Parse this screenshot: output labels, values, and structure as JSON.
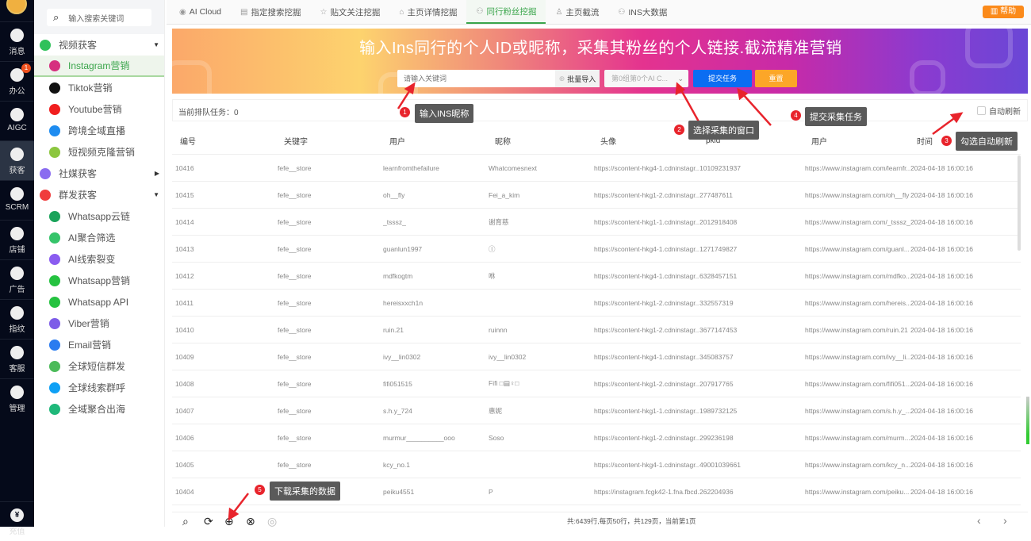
{
  "rail": {
    "items": [
      {
        "label": "消息",
        "icon": "message-icon"
      },
      {
        "label": "办公",
        "icon": "office-icon",
        "badge": "1"
      },
      {
        "label": "AIGC",
        "icon": "aigc-icon"
      },
      {
        "label": "获客",
        "icon": "customer-icon",
        "active": true
      },
      {
        "label": "SCRM",
        "icon": "scrm-icon"
      },
      {
        "label": "店铺",
        "icon": "store-icon"
      },
      {
        "label": "广告",
        "icon": "ads-icon"
      },
      {
        "label": "指纹",
        "icon": "fingerprint-icon"
      },
      {
        "label": "客服",
        "icon": "service-icon"
      },
      {
        "label": "管理",
        "icon": "manage-icon"
      }
    ],
    "bottom": {
      "label": "充值",
      "icon": "recharge-icon"
    }
  },
  "sidebar": {
    "search_placeholder": "输入搜索关键词",
    "groups": [
      {
        "label": "视频获客",
        "color": "#2fc15a",
        "expanded": true,
        "items": [
          {
            "label": "Instagram营销",
            "color": "#d6307f",
            "active": true
          },
          {
            "label": "Tiktok营销",
            "color": "#111"
          },
          {
            "label": "Youtube营销",
            "color": "#f01e1e"
          },
          {
            "label": "跨境全域直播",
            "color": "#1e8cf0"
          },
          {
            "label": "短视频克隆营销",
            "color": "#8cc63f"
          }
        ]
      },
      {
        "label": "社媒获客",
        "color": "#8a6cf0",
        "expanded": false,
        "items": []
      },
      {
        "label": "群发获客",
        "color": "#f03c3c",
        "expanded": true,
        "items": [
          {
            "label": "Whatsapp云链",
            "color": "#1aa35a"
          },
          {
            "label": "AI聚合筛选",
            "color": "#35c46a"
          },
          {
            "label": "AI线索裂变",
            "color": "#8a5cf0"
          },
          {
            "label": "Whatsapp营销",
            "color": "#25c240"
          },
          {
            "label": "Whatsapp API",
            "color": "#25c240"
          },
          {
            "label": "Viber营销",
            "color": "#7d5ce8"
          },
          {
            "label": "Email营销",
            "color": "#2a7cf0"
          },
          {
            "label": "全球短信群发",
            "color": "#4cbb5a"
          },
          {
            "label": "全球线索群呼",
            "color": "#0ea0f5"
          },
          {
            "label": "全域聚合出海",
            "color": "#1fb87a"
          }
        ]
      }
    ]
  },
  "tabs": [
    {
      "label": "AI Cloud",
      "icon": "cloud-icon"
    },
    {
      "label": "指定搜索挖掘",
      "icon": "search-doc-icon"
    },
    {
      "label": "贴文关注挖掘",
      "icon": "star-icon"
    },
    {
      "label": "主页详情挖掘",
      "icon": "home-icon"
    },
    {
      "label": "同行粉丝挖掘",
      "icon": "users-icon",
      "active": true
    },
    {
      "label": "主页截流",
      "icon": "user-icon"
    },
    {
      "label": "INS大数据",
      "icon": "users-icon"
    }
  ],
  "help_label": "帮助",
  "banner": {
    "title": "输入Ins同行的个人ID或昵称，采集其粉丝的个人链接.截流精准营销",
    "keyword_placeholder": "请输入关键词",
    "import_label": "批量导入",
    "window_select": "第0组第0个AI C...",
    "submit_label": "提交任务",
    "reset_label": "重置"
  },
  "queue": {
    "label": "当前排队任务：",
    "count": "0",
    "auto_refresh_label": "自动刷新",
    "auto_refresh_checked": false
  },
  "table": {
    "headers": [
      "编号",
      "关键字",
      "用户",
      "昵称",
      "头像",
      "pkid",
      "用户",
      "时间"
    ],
    "rows": [
      [
        "10416",
        "fefe__store",
        "learnfromthefailure",
        "Whatcomesnext",
        "https://scontent-hkg4-1.cdninstagr...",
        "10109231937",
        "https://www.instagram.com/learnfr...",
        "2024-04-18 16:00:16"
      ],
      [
        "10415",
        "fefe__store",
        "oh__fly",
        "Fei_a_kim",
        "https://scontent-hkg1-2.cdninstagr...",
        "277487611",
        "https://www.instagram.com/oh__fly",
        "2024-04-18 16:00:16"
      ],
      [
        "10414",
        "fefe__store",
        "_tsssz_",
        "谢育慈",
        "https://scontent-hkg1-1.cdninstagr...",
        "2012918408",
        "https://www.instagram.com/_tsssz_",
        "2024-04-18 16:00:16"
      ],
      [
        "10413",
        "fefe__store",
        "guanlun1997",
        "ⓛ",
        "https://scontent-hkg4-1.cdninstagr...",
        "1271749827",
        "https://www.instagram.com/guanl...",
        "2024-04-18 16:00:16"
      ],
      [
        "10412",
        "fefe__store",
        "mdfkogtm",
        "咻",
        "https://scontent-hkg4-1.cdninstagr...",
        "6328457151",
        "https://www.instagram.com/mdfko...",
        "2024-04-18 16:00:16"
      ],
      [
        "10411",
        "fefe__store",
        "hereisxxch1n",
        "",
        "https://scontent-hkg1-2.cdninstagr...",
        "332557319",
        "https://www.instagram.com/hereis...",
        "2024-04-18 16:00:16"
      ],
      [
        "10410",
        "fefe__store",
        "ruin.21",
        "ruinnn",
        "https://scontent-hkg1-2.cdninstagr...",
        "3677147453",
        "https://www.instagram.com/ruin.21",
        "2024-04-18 16:00:16"
      ],
      [
        "10409",
        "fefe__store",
        "ivy__lin0302",
        "ivy__lin0302",
        "https://scontent-hkg4-1.cdninstagr...",
        "345083757",
        "https://www.instagram.com/ivy__li...",
        "2024-04-18 16:00:16"
      ],
      [
        "10408",
        "fefe__store",
        "fifi051515",
        "Fifi □▤♀□",
        "https://scontent-hkg1-2.cdninstagr...",
        "207917765",
        "https://www.instagram.com/fifi051...",
        "2024-04-18 16:00:16"
      ],
      [
        "10407",
        "fefe__store",
        "s.h.y_724",
        "惠妮",
        "https://scontent-hkg1-1.cdninstagr...",
        "1989732125",
        "https://www.instagram.com/s.h.y_...",
        "2024-04-18 16:00:16"
      ],
      [
        "10406",
        "fefe__store",
        "murmur__________ooo",
        "Soso",
        "https://scontent-hkg1-2.cdninstagr...",
        "299236198",
        "https://www.instagram.com/murm...",
        "2024-04-18 16:00:16"
      ],
      [
        "10405",
        "fefe__store",
        "kcy_no.1",
        "",
        "https://scontent-hkg4-1.cdninstagr...",
        "49001039661",
        "https://www.instagram.com/kcy_n...",
        "2024-04-18 16:00:16"
      ],
      [
        "10404",
        "fefe__store",
        "peiku4551",
        "P",
        "https://instagram.fcgk42-1.fna.fbcd...",
        "262204936",
        "https://www.instagram.com/peiku...",
        "2024-04-18 16:00:16"
      ]
    ]
  },
  "footer": {
    "pagination": "共:6439行,每页50行，共129页，当前第1页",
    "prev": "‹",
    "next": "›"
  },
  "annotations": [
    {
      "num": "1",
      "text": "输入INS昵称"
    },
    {
      "num": "2",
      "text": "选择采集的窗口"
    },
    {
      "num": "3",
      "text": "勾选自动刷新"
    },
    {
      "num": "4",
      "text": "提交采集任务"
    },
    {
      "num": "5",
      "text": "下载采集的数据"
    }
  ],
  "colors": {
    "accent": "#3aa54b",
    "submit": "#0b6df2",
    "reset": "#fca628",
    "help": "#fb8a1a",
    "rail": "#050a1a",
    "annotation": "#e8242c"
  }
}
